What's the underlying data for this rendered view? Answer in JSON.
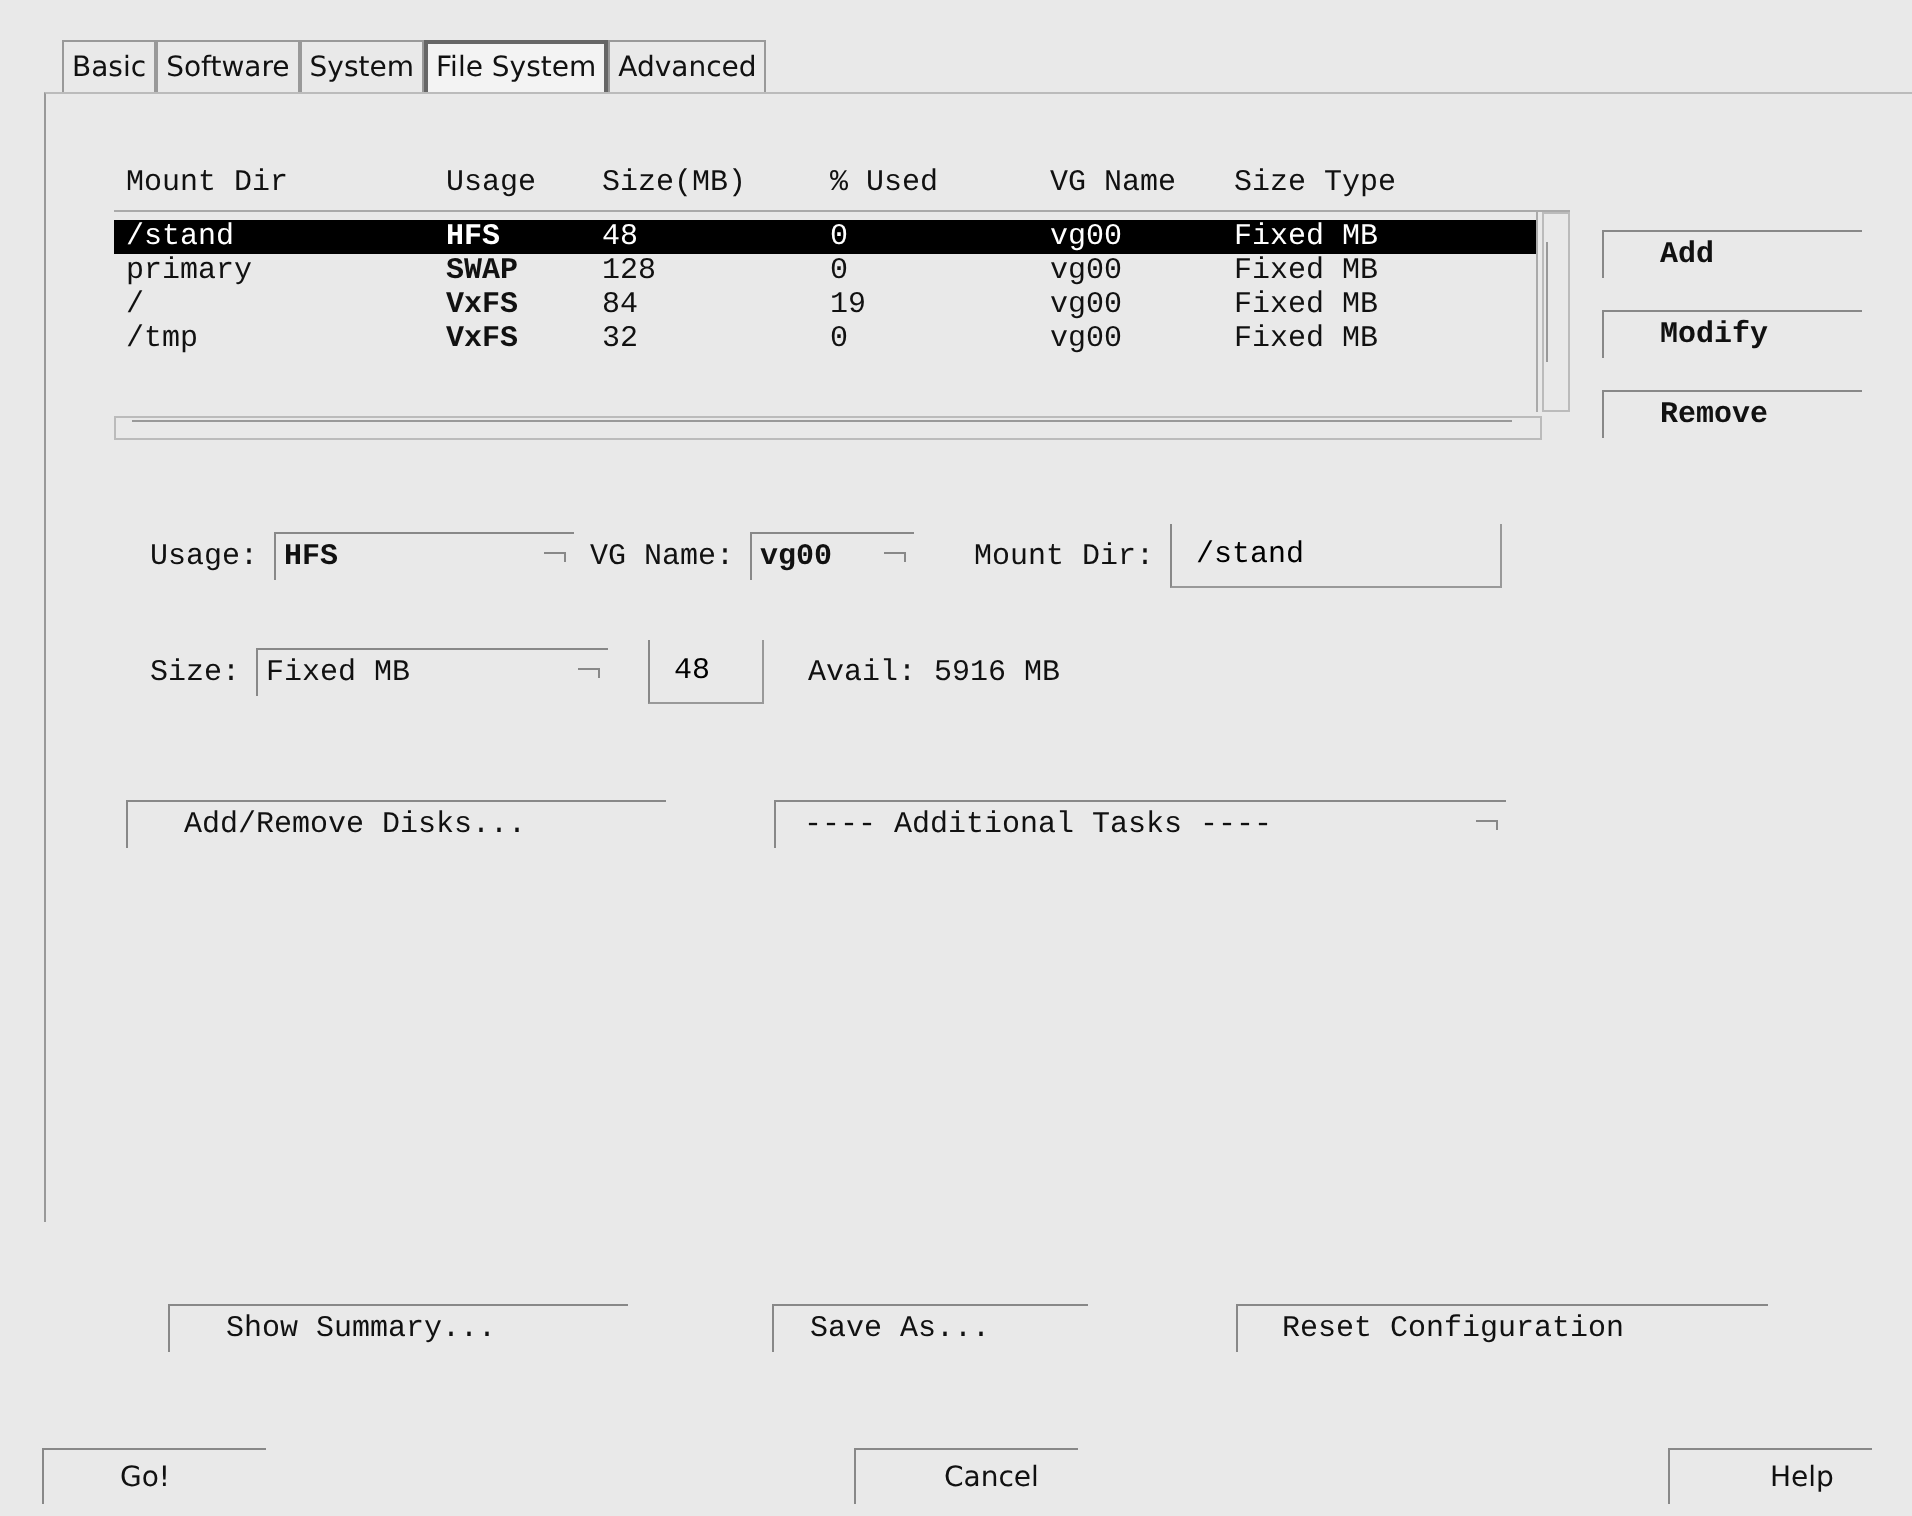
{
  "tabs": [
    {
      "label": "Basic",
      "selected": false
    },
    {
      "label": "Software",
      "selected": false
    },
    {
      "label": "System",
      "selected": false
    },
    {
      "label": "File System",
      "selected": true
    },
    {
      "label": "Advanced",
      "selected": false
    }
  ],
  "table": {
    "columns": [
      "Mount Dir",
      "Usage",
      "Size(MB)",
      "% Used",
      "VG Name",
      "Size Type"
    ],
    "rows": [
      {
        "selected": true,
        "cells": [
          "/stand",
          "HFS",
          "48",
          "0",
          "vg00",
          "Fixed MB"
        ]
      },
      {
        "selected": false,
        "cells": [
          "primary",
          "SWAP",
          "128",
          "0",
          "vg00",
          "Fixed MB"
        ]
      },
      {
        "selected": false,
        "cells": [
          "/",
          "VxFS",
          "84",
          "19",
          "vg00",
          "Fixed MB"
        ]
      },
      {
        "selected": false,
        "cells": [
          "/tmp",
          "VxFS",
          "32",
          "0",
          "vg00",
          "Fixed MB"
        ]
      }
    ]
  },
  "side_buttons": [
    "Add",
    "Modify",
    "Remove"
  ],
  "form": {
    "usage": {
      "label": "Usage:",
      "value": "HFS"
    },
    "vg_name": {
      "label": "VG Name:",
      "value": "vg00"
    },
    "mount_dir": {
      "label": "Mount Dir:",
      "value": "/stand"
    },
    "size": {
      "label": "Size:",
      "value": "Fixed MB"
    },
    "size_value": "48",
    "avail": "Avail: 5916 MB"
  },
  "disks_button": "Add/Remove Disks...",
  "tasks_menu": "---- Additional Tasks ----",
  "action_buttons": [
    "Show Summary...",
    "Save As...",
    "Reset Configuration"
  ],
  "bottom_buttons": [
    "Go!",
    "Cancel",
    "Help"
  ]
}
